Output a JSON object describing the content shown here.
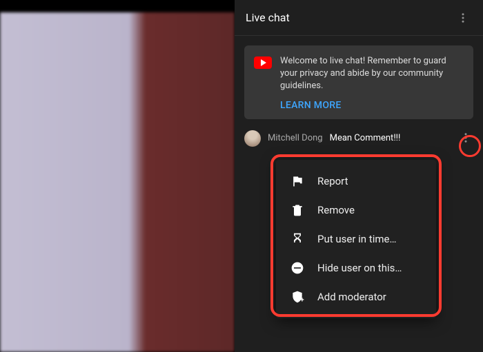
{
  "chat": {
    "title": "Live chat",
    "welcome": {
      "text": "Welcome to live chat! Remember to guard your privacy and abide by our community guidelines.",
      "learn_more": "LEARN MORE"
    },
    "message": {
      "author": "Mitchell Dong",
      "text": "Mean Comment!!!"
    },
    "menu": {
      "report": "Report",
      "remove": "Remove",
      "timeout": "Put user in time…",
      "hide": "Hide user on this…",
      "moderator": "Add moderator"
    }
  }
}
